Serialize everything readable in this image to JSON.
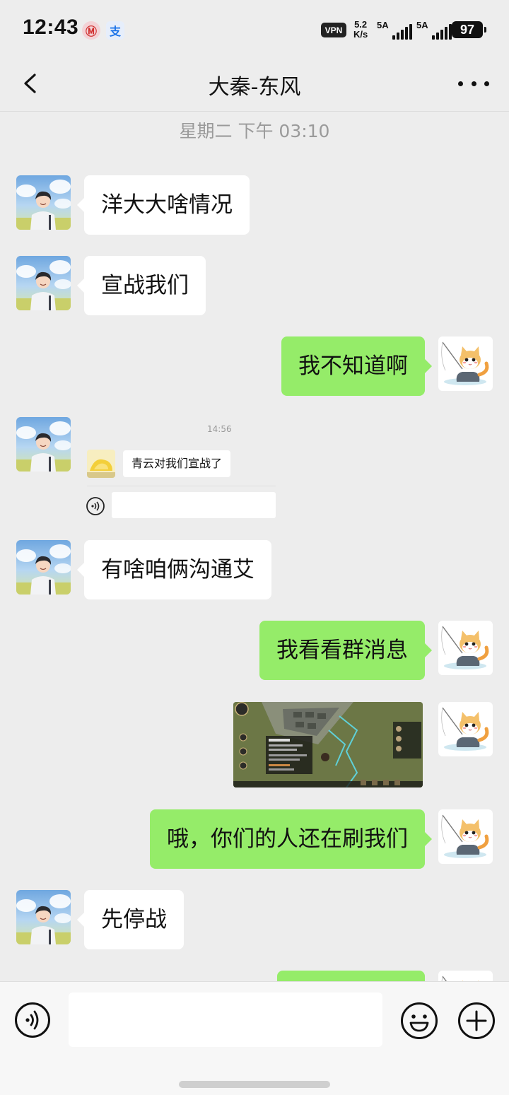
{
  "status_bar": {
    "time": "12:43",
    "app_icon_1": "Ⓜ",
    "app_icon_2": "支",
    "vpn": "VPN",
    "speed_value": "5.2",
    "speed_unit": "K/s",
    "sim1_label": "5A",
    "sim2_label": "5A",
    "battery": "97"
  },
  "header": {
    "title": "大秦-东风",
    "back_icon": "chevron-left-icon",
    "more_icon": "more-horizontal-icon"
  },
  "timestamp": "星期二 下午 03:10",
  "messages": [
    {
      "side": "in",
      "text": "洋大大啥情况"
    },
    {
      "side": "in",
      "text": "宣战我们"
    },
    {
      "side": "out",
      "text": "我不知道啊"
    },
    {
      "side": "in",
      "type": "card",
      "card_time": "14:56",
      "card_text": "青云对我们宣战了"
    },
    {
      "side": "in",
      "text": "有啥咱俩沟通艾"
    },
    {
      "side": "out",
      "text": "我看看群消息"
    },
    {
      "side": "out",
      "type": "image"
    },
    {
      "side": "out",
      "text": "哦，你们的人还在刷我们"
    },
    {
      "side": "in",
      "text": "先停战"
    },
    {
      "side": "out",
      "text": ""
    }
  ],
  "input_bar": {
    "placeholder": "",
    "voice_icon": "voice-icon",
    "emoji_icon": "emoji-icon",
    "plus_icon": "plus-icon"
  },
  "colors": {
    "background": "#ededed",
    "outgoing_bubble": "#95ec69",
    "incoming_bubble": "#ffffff",
    "timestamp": "#9a9a9a"
  }
}
